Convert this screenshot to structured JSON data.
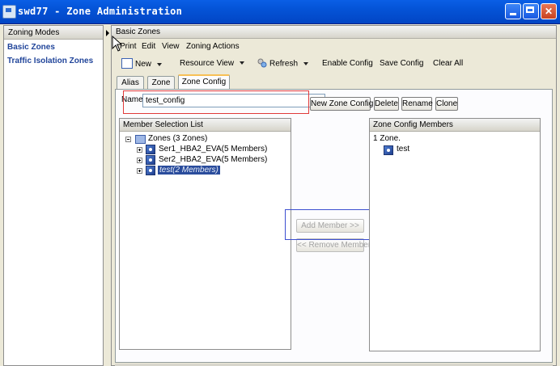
{
  "window": {
    "title": "swd77 - Zone Administration"
  },
  "left_pane": {
    "header": "Zoning Modes",
    "items": [
      "Basic Zones",
      "Traffic Isolation Zones"
    ]
  },
  "right_pane": {
    "header": "Basic Zones",
    "menu": [
      "Print",
      "Edit",
      "View",
      "Zoning Actions"
    ],
    "toolbar": {
      "new": "New",
      "resource_view": "Resource View",
      "refresh": "Refresh",
      "enable_config": "Enable Config",
      "save_config": "Save Config",
      "clear_all": "Clear All"
    },
    "tabs": [
      "Alias",
      "Zone",
      "Zone Config"
    ],
    "active_tab": "Zone Config",
    "name_label": "Name",
    "name_value": "test_config",
    "buttons": {
      "new_zone_config": "New Zone Config",
      "delete": "Delete",
      "rename": "Rename",
      "clone": "Clone",
      "add_member": "Add Member >>",
      "remove_member": "<< Remove Member"
    },
    "member_selection": {
      "header": "Member Selection List",
      "root": "Zones (3 Zones)",
      "zones": [
        {
          "label": "Ser1_HBA2_EVA(5 Members)",
          "selected": false
        },
        {
          "label": "Ser2_HBA2_EVA(5 Members)",
          "selected": false
        },
        {
          "label": "test(2 Members)",
          "selected": true
        }
      ]
    },
    "config_members": {
      "header": "Zone Config Members",
      "count": "1 Zone.",
      "items": [
        "test"
      ]
    }
  },
  "colors": {
    "title_bar": "#0453D6",
    "selection": "#2A4C9C",
    "highlight_red": "#E03A3A",
    "highlight_blue": "#3C4FD0",
    "link_text": "#21459A"
  }
}
